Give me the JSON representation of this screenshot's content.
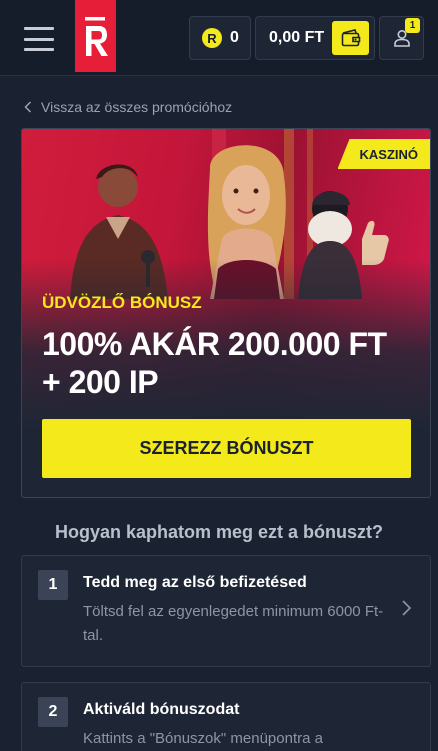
{
  "header": {
    "logo_letter": "R",
    "coins": "0",
    "coin_symbol": "R",
    "balance": "0,00 FT",
    "notification_count": "1"
  },
  "back_link": {
    "label": "Vissza az összes promócióhoz"
  },
  "promo": {
    "tag": "KASZINÓ",
    "kicker": "ÜDVÖZLŐ BÓNUSZ",
    "title_line1": "100% AKÁR 200.000 FT",
    "title_line2": "+ 200 IP",
    "cta": "SZEREZZ BÓNUSZT"
  },
  "howto": {
    "title": "Hogyan kaphatom meg ezt a bónuszt?",
    "steps": [
      {
        "number": "1",
        "title": "Tedd meg az első befizetésed",
        "description": "Töltsd fel az egyenlegedet minimum 6000 Ft-tal."
      },
      {
        "number": "2",
        "title": "Aktiváld bónuszodat",
        "description": "Kattints a \"Bónuszok\" menüpontra a"
      }
    ]
  },
  "colors": {
    "accent": "#f4ea1b",
    "brand_red": "#e61e38",
    "background": "#1a2130"
  }
}
